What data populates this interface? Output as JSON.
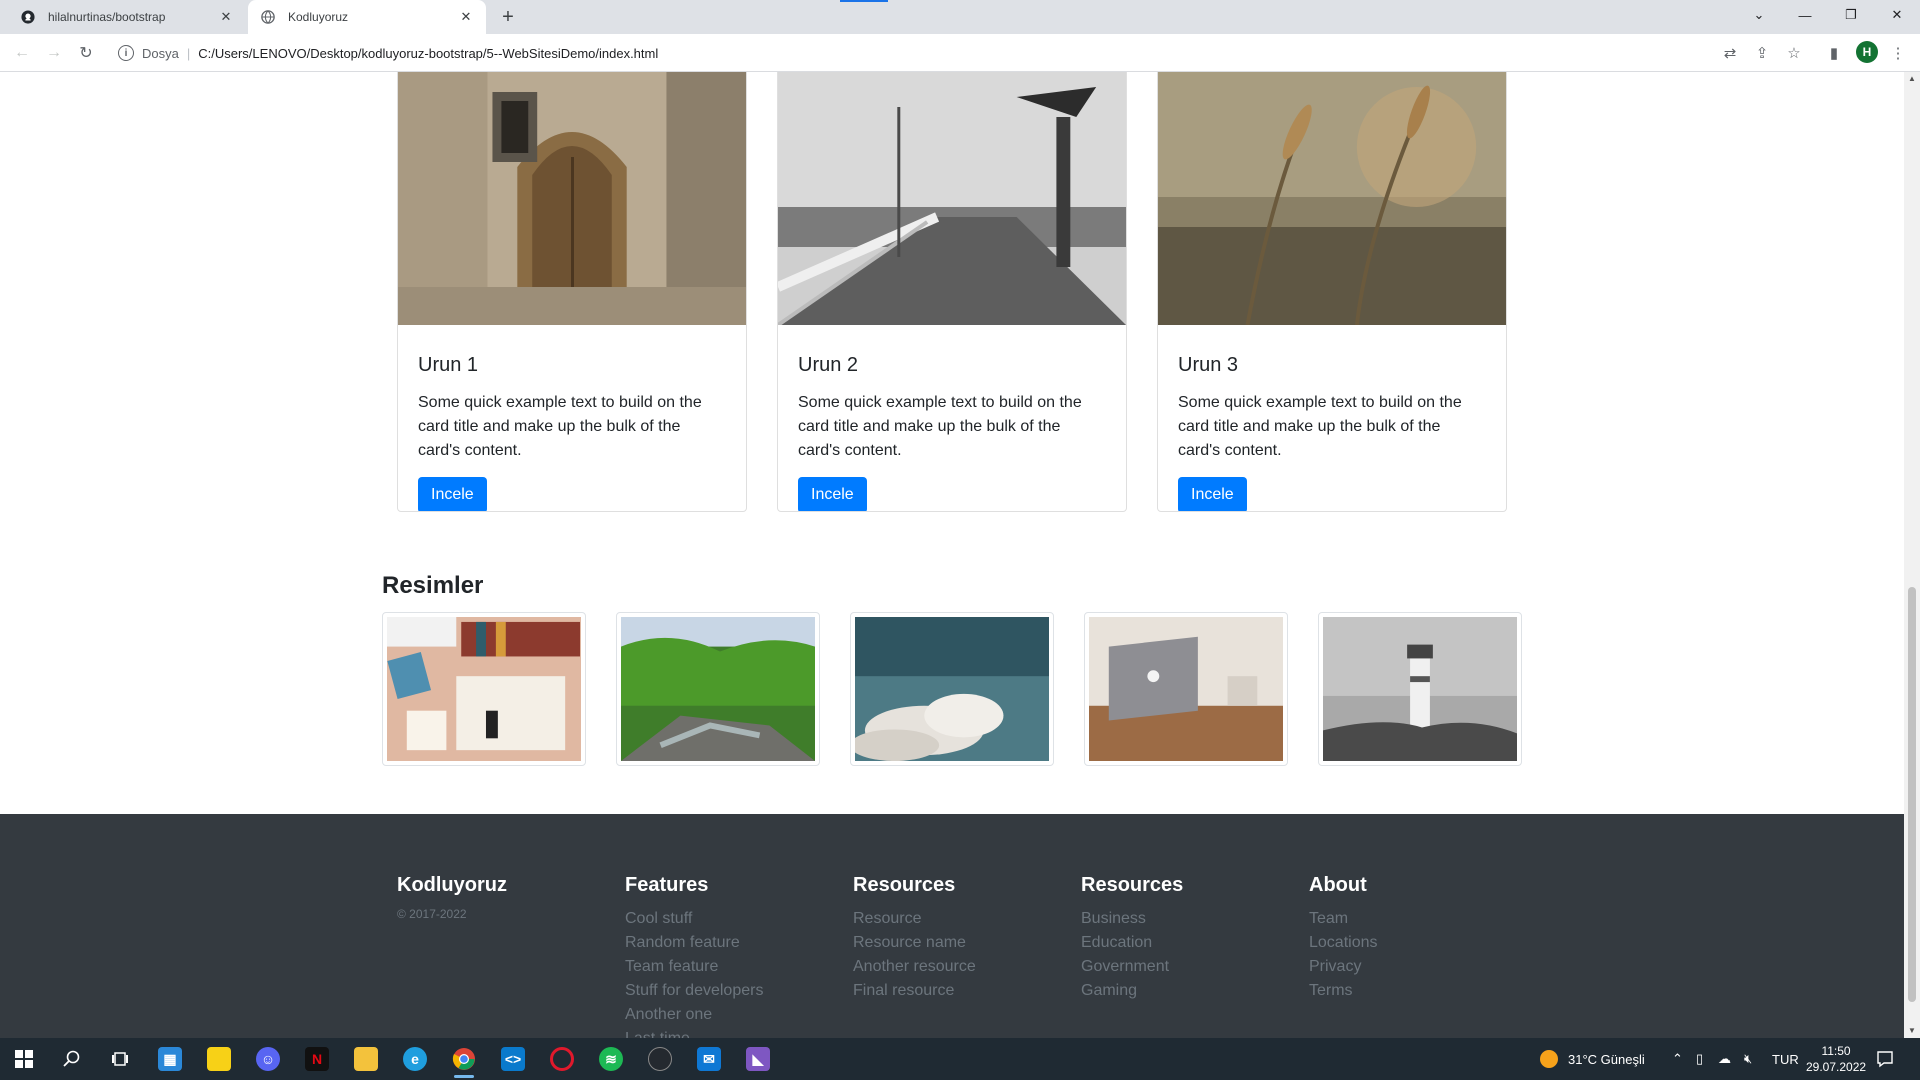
{
  "browser": {
    "tabs": [
      {
        "title": "hilalnurtinas/bootstrap",
        "icon": "github-icon"
      },
      {
        "title": "Kodluyoruz",
        "icon": "globe-icon"
      }
    ],
    "address": {
      "scheme": "Dosya",
      "url": "C:/Users/LENOVO/Desktop/kodluyoruz-bootstrap/5--WebSitesiDemo/index.html"
    },
    "profile_initial": "H"
  },
  "cards": [
    {
      "title": "Urun 1",
      "text": "Some quick example text to build on the card title and make up the bulk of the card's content.",
      "button": "Incele"
    },
    {
      "title": "Urun 2",
      "text": "Some quick example text to build on the card title and make up the bulk of the card's content.",
      "button": "Incele"
    },
    {
      "title": "Urun 3",
      "text": "Some quick example text to build on the card title and make up the bulk of the card's content.",
      "button": "Incele"
    }
  ],
  "gallery": {
    "title": "Resimler",
    "images": [
      "desk-flatlay",
      "forest-stream",
      "sky-clouds",
      "laptop-desk",
      "lighthouse"
    ]
  },
  "footer": {
    "brand": "Kodluyoruz",
    "copyright": "© 2017-2022",
    "columns": [
      {
        "title": "Features",
        "links": [
          "Cool stuff",
          "Random feature",
          "Team feature",
          "Stuff for developers",
          "Another one",
          "Last time"
        ]
      },
      {
        "title": "Resources",
        "links": [
          "Resource",
          "Resource name",
          "Another resource",
          "Final resource"
        ]
      },
      {
        "title": "Resources",
        "links": [
          "Business",
          "Education",
          "Government",
          "Gaming"
        ]
      },
      {
        "title": "About",
        "links": [
          "Team",
          "Locations",
          "Privacy",
          "Terms"
        ]
      }
    ]
  },
  "taskbar": {
    "weather": "31°C  Güneşli",
    "lang": "TUR",
    "time": "11:50",
    "date": "29.07.2022"
  },
  "colors": {
    "primary": "#007bff",
    "footer_bg": "#343a40",
    "muted": "#6c757d"
  }
}
